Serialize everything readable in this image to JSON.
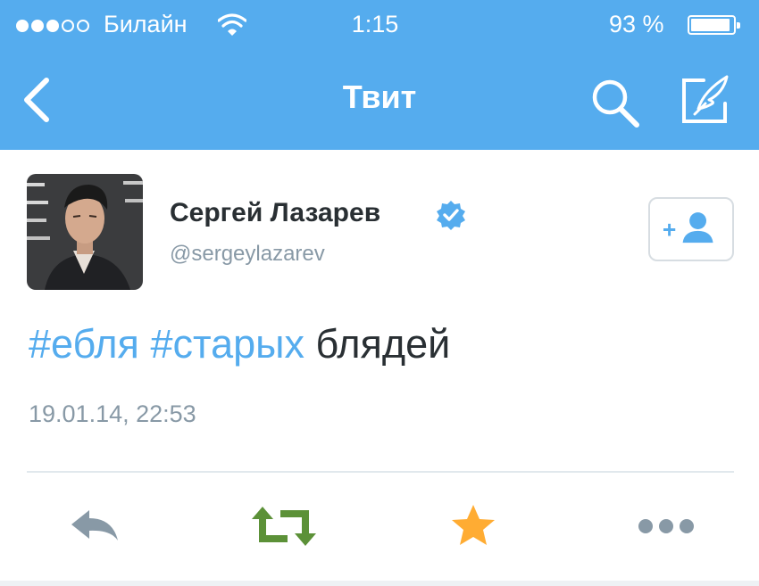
{
  "status_bar": {
    "carrier": "Билайн",
    "time": "1:15",
    "battery_text": "93 %",
    "battery_level": 0.93,
    "signal_bars": 3
  },
  "nav": {
    "title": "Твит",
    "icons": [
      "back-icon",
      "search-icon",
      "compose-icon"
    ]
  },
  "tweet": {
    "author_name": "Сергей Лазарев",
    "author_handle": "@sergeylazarev",
    "verified": true,
    "text_parts": [
      {
        "text": "#ебля",
        "hashtag": true
      },
      {
        "text": " ",
        "hashtag": false
      },
      {
        "text": "#старых",
        "hashtag": true
      },
      {
        "text": " блядей",
        "hashtag": false
      }
    ],
    "timestamp": "19.01.14, 22:53"
  },
  "actions": {
    "icons": [
      "reply-icon",
      "retweet-icon",
      "favorite-icon",
      "more-icon"
    ]
  },
  "colors": {
    "brand": "#55acee",
    "retweet": "#5c9138",
    "favorite": "#ffac33",
    "muted": "#8899a6",
    "text": "#292f33"
  }
}
